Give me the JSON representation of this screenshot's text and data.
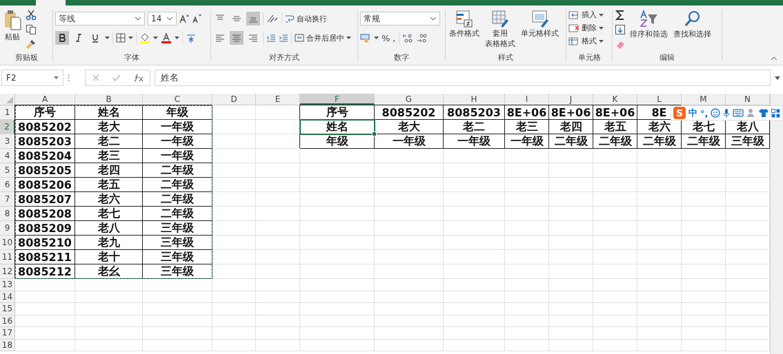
{
  "clipboard": {
    "title": "剪贴板",
    "paste_label": "粘贴"
  },
  "font": {
    "title": "字体",
    "font_name": "等线",
    "font_size": "14",
    "bold_pressed": true,
    "italic_pressed": false,
    "underline_pressed": false
  },
  "alignment": {
    "title": "对齐方式",
    "wrap_text": "自动换行",
    "merge_center": "合并后居中",
    "vertical_align": [
      {
        "kind": "top",
        "selected": false
      },
      {
        "kind": "middle",
        "selected": false
      },
      {
        "kind": "bottom",
        "selected": true
      }
    ],
    "horizontal_align": [
      {
        "kind": "left",
        "selected": false
      },
      {
        "kind": "center",
        "selected": true
      },
      {
        "kind": "right",
        "selected": false
      }
    ]
  },
  "number": {
    "title": "数字",
    "format": "常规",
    "percent": "%",
    "comma": ","
  },
  "styles": {
    "title": "样式",
    "buttons": [
      {
        "lines": [
          "条件格式"
        ]
      },
      {
        "lines": [
          "套用",
          "表格格式"
        ]
      },
      {
        "lines": [
          "单元格样式"
        ]
      }
    ]
  },
  "cells": {
    "title": "单元格",
    "buttons": [
      "插入",
      "删除",
      "格式"
    ]
  },
  "editing": {
    "title": "编辑",
    "buttons": [
      "排序和筛选",
      "查找和选择"
    ]
  },
  "formula_bar": {
    "name_box": "F2",
    "formula": "姓名"
  },
  "sheet": {
    "copy_marquee": true,
    "columns": [
      {
        "label": "A",
        "selected": false
      },
      {
        "label": "B",
        "selected": false
      },
      {
        "label": "C",
        "selected": false
      },
      {
        "label": "D",
        "selected": false
      },
      {
        "label": "E",
        "selected": false
      },
      {
        "label": "F",
        "selected": true
      },
      {
        "label": "G",
        "selected": false
      },
      {
        "label": "H",
        "selected": false
      },
      {
        "label": "I",
        "selected": false
      },
      {
        "label": "J",
        "selected": false
      },
      {
        "label": "K",
        "selected": false
      },
      {
        "label": "L",
        "selected": false
      },
      {
        "label": "M",
        "selected": false
      },
      {
        "label": "N",
        "selected": false
      }
    ],
    "rows": [
      {
        "label": "1",
        "selected": false,
        "cells": [
          {
            "text": "序号",
            "selected": false
          },
          {
            "text": "姓名",
            "selected": false
          },
          {
            "text": "年级",
            "selected": false
          },
          null,
          null,
          {
            "text": "序号",
            "selected": false
          },
          {
            "text": "8085202",
            "selected": false
          },
          {
            "text": "8085203",
            "selected": false
          },
          {
            "text": "8E+06",
            "selected": false
          },
          {
            "text": "8E+06",
            "selected": false
          },
          {
            "text": "8E+06",
            "selected": false
          },
          {
            "text": "8E",
            "selected": false
          },
          null,
          null
        ]
      },
      {
        "label": "2",
        "selected": true,
        "cells": [
          {
            "text": "8085202",
            "selected": false
          },
          {
            "text": "老大",
            "selected": false
          },
          {
            "text": "一年级",
            "selected": false
          },
          null,
          null,
          {
            "text": "姓名",
            "selected": true
          },
          {
            "text": "老大",
            "selected": false
          },
          {
            "text": "老二",
            "selected": false
          },
          {
            "text": "老三",
            "selected": false
          },
          {
            "text": "老四",
            "selected": false
          },
          {
            "text": "老五",
            "selected": false
          },
          {
            "text": "老六",
            "selected": false
          },
          {
            "text": "老七",
            "selected": false
          },
          {
            "text": "老八",
            "selected": false
          }
        ]
      },
      {
        "label": "3",
        "selected": false,
        "cells": [
          {
            "text": "8085203",
            "selected": false
          },
          {
            "text": "老二",
            "selected": false
          },
          {
            "text": "一年级",
            "selected": false
          },
          null,
          null,
          {
            "text": "年级",
            "selected": false
          },
          {
            "text": "一年级",
            "selected": false
          },
          {
            "text": "一年级",
            "selected": false
          },
          {
            "text": "一年级",
            "selected": false
          },
          {
            "text": "二年级",
            "selected": false
          },
          {
            "text": "二年级",
            "selected": false
          },
          {
            "text": "二年级",
            "selected": false
          },
          {
            "text": "二年级",
            "selected": false
          },
          {
            "text": "三年级",
            "selected": false
          }
        ]
      },
      {
        "label": "4",
        "selected": false,
        "cells": [
          {
            "text": "8085204",
            "selected": false
          },
          {
            "text": "老三",
            "selected": false
          },
          {
            "text": "一年级",
            "selected": false
          }
        ]
      },
      {
        "label": "5",
        "selected": false,
        "cells": [
          {
            "text": "8085205",
            "selected": false
          },
          {
            "text": "老四",
            "selected": false
          },
          {
            "text": "二年级",
            "selected": false
          }
        ]
      },
      {
        "label": "6",
        "selected": false,
        "cells": [
          {
            "text": "8085206",
            "selected": false
          },
          {
            "text": "老五",
            "selected": false
          },
          {
            "text": "二年级",
            "selected": false
          }
        ]
      },
      {
        "label": "7",
        "selected": false,
        "cells": [
          {
            "text": "8085207",
            "selected": false
          },
          {
            "text": "老六",
            "selected": false
          },
          {
            "text": "二年级",
            "selected": false
          }
        ]
      },
      {
        "label": "8",
        "selected": false,
        "cells": [
          {
            "text": "8085208",
            "selected": false
          },
          {
            "text": "老七",
            "selected": false
          },
          {
            "text": "二年级",
            "selected": false
          }
        ]
      },
      {
        "label": "9",
        "selected": false,
        "cells": [
          {
            "text": "8085209",
            "selected": false
          },
          {
            "text": "老八",
            "selected": false
          },
          {
            "text": "三年级",
            "selected": false
          }
        ]
      },
      {
        "label": "10",
        "selected": false,
        "cells": [
          {
            "text": "8085210",
            "selected": false
          },
          {
            "text": "老九",
            "selected": false
          },
          {
            "text": "三年级",
            "selected": false
          }
        ]
      },
      {
        "label": "11",
        "selected": false,
        "cells": [
          {
            "text": "8085211",
            "selected": false
          },
          {
            "text": "老十",
            "selected": false
          },
          {
            "text": "三年级",
            "selected": false
          }
        ]
      },
      {
        "label": "12",
        "selected": false,
        "cells": [
          {
            "text": "8085212",
            "selected": false
          },
          {
            "text": "老幺",
            "selected": false
          },
          {
            "text": "三年级",
            "selected": false
          }
        ]
      },
      {
        "label": "13",
        "selected": false
      },
      {
        "label": "14",
        "selected": false
      },
      {
        "label": "15",
        "selected": false
      },
      {
        "label": "16",
        "selected": false
      },
      {
        "label": "17",
        "selected": false
      },
      {
        "label": "18",
        "selected": false
      }
    ]
  },
  "ime_toolbar": {
    "logo": "S",
    "mode": "中",
    "punctuation": "°,"
  }
}
